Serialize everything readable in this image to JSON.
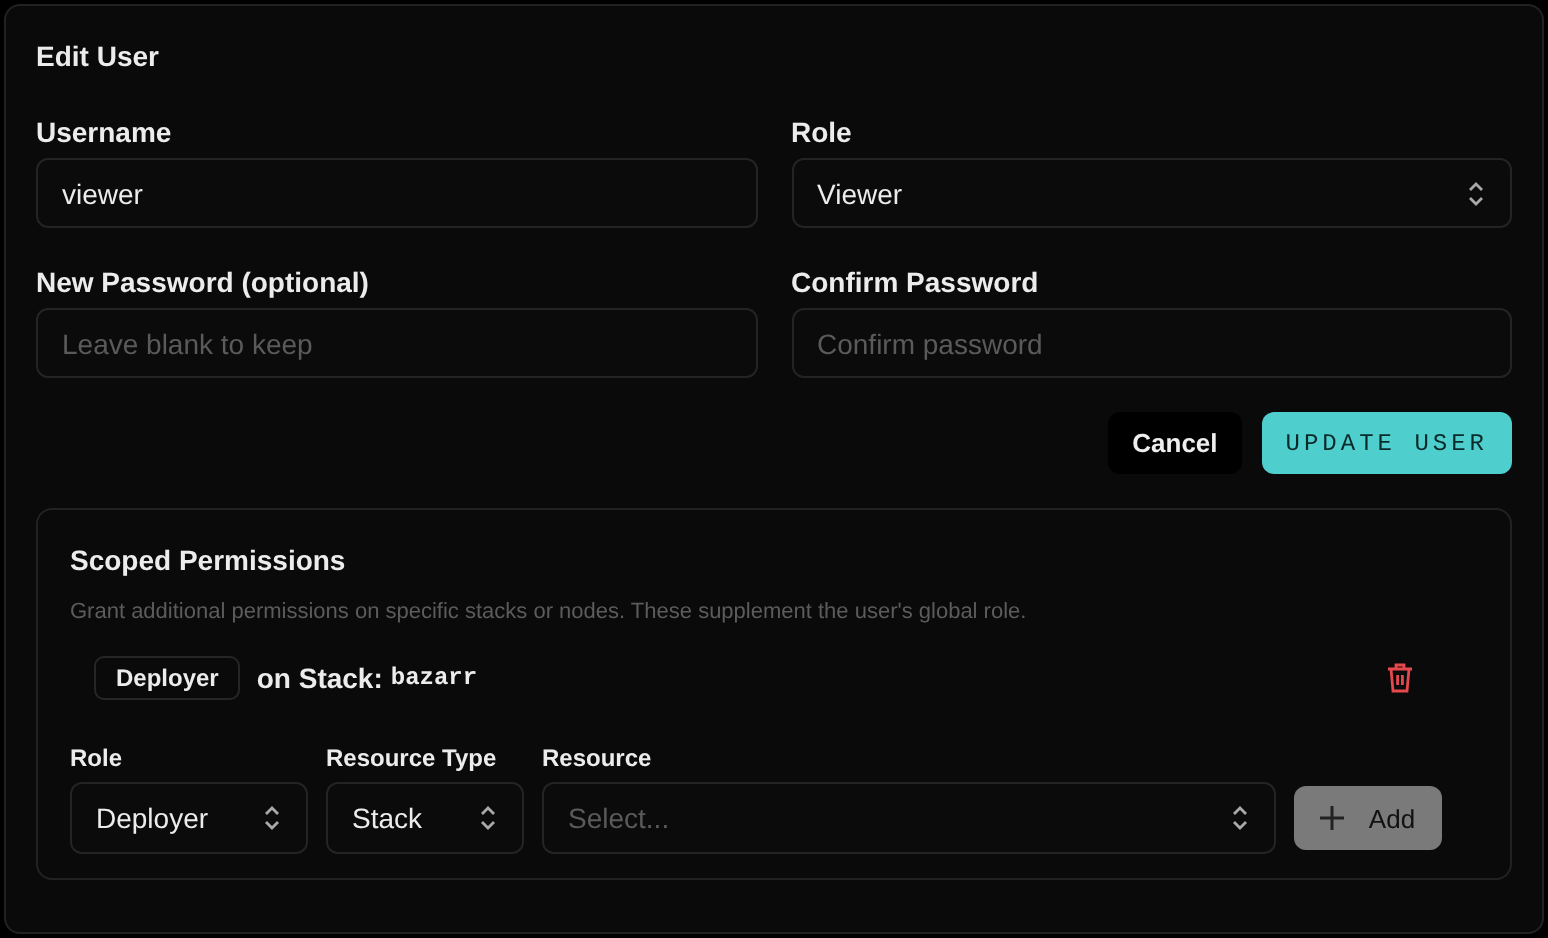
{
  "dialog": {
    "title": "Edit User"
  },
  "fields": [
    {
      "label": "Username",
      "kind": "input",
      "value": "viewer"
    },
    {
      "label": "Role",
      "kind": "select",
      "value": "Viewer"
    },
    {
      "label": "New Password (optional)",
      "kind": "input",
      "placeholder": "Leave blank to keep"
    },
    {
      "label": "Confirm Password",
      "kind": "input",
      "placeholder": "Confirm password"
    }
  ],
  "buttons": {
    "cancel": "Cancel",
    "submit": "UPDATE USER"
  },
  "scoped": {
    "title": "Scoped Permissions",
    "description": "Grant additional permissions on specific stacks or nodes. These supplement the user's global role.",
    "permissions": [
      {
        "role": "Deployer",
        "scope": "on Stack:",
        "resource": "bazarr"
      }
    ],
    "form": [
      {
        "label": "Role",
        "kind": "select",
        "value": "Deployer"
      },
      {
        "label": "Resource Type",
        "kind": "select",
        "value": "Stack"
      },
      {
        "label": "Resource",
        "kind": "select",
        "placeholder": "Select..."
      }
    ],
    "add": {
      "label": "Add",
      "disabled": true
    }
  }
}
